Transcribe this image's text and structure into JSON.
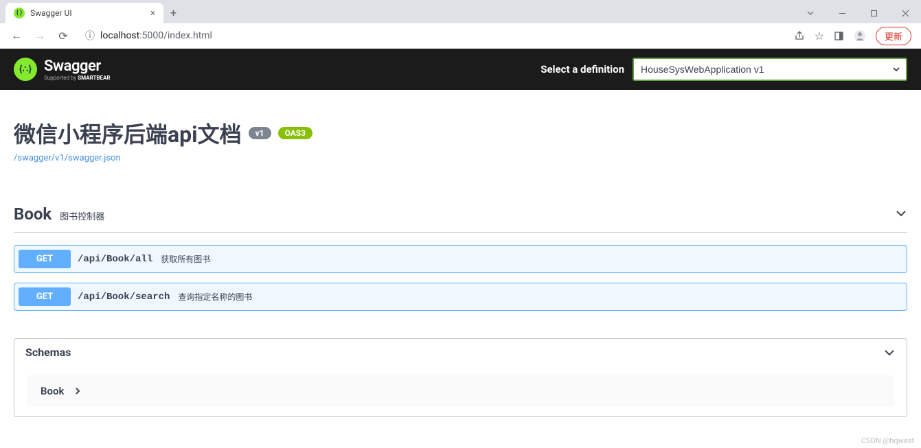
{
  "browser": {
    "tab_title": "Swagger UI",
    "url_host": "localhost",
    "url_port": ":5000",
    "url_path": "/index.html",
    "update_label": "更新"
  },
  "topbar": {
    "logo_main": "Swagger",
    "logo_sub_prefix": "Supported by ",
    "logo_sub_bold": "SMARTBEAR",
    "select_label": "Select a definition",
    "definition": "HouseSysWebApplication v1"
  },
  "info": {
    "title": "微信小程序后端api文档",
    "version": "v1",
    "oas": "OAS3",
    "spec_url": "/swagger/v1/swagger.json"
  },
  "tag": {
    "name": "Book",
    "description": "图书控制器"
  },
  "operations": [
    {
      "method": "GET",
      "path": "/api/Book/all",
      "summary": "获取所有图书"
    },
    {
      "method": "GET",
      "path": "/api/Book/search",
      "summary": "查询指定名称的图书"
    }
  ],
  "schemas": {
    "title": "Schemas",
    "items": [
      {
        "name": "Book"
      }
    ]
  },
  "watermark": "CSDN @hqwest"
}
